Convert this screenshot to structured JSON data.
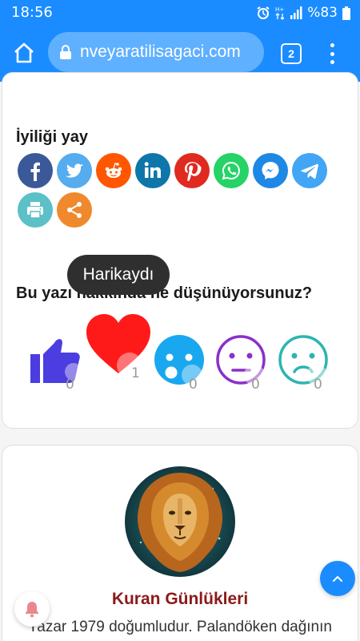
{
  "status_bar": {
    "time": "18:56",
    "battery": "%83"
  },
  "browser": {
    "url": "nveyaratilisagaci.com",
    "tab_count": "2"
  },
  "share": {
    "title": "İyiliği yay",
    "buttons": [
      {
        "icon": "facebook-icon",
        "color": "#3b5998"
      },
      {
        "icon": "twitter-icon",
        "color": "#55acee"
      },
      {
        "icon": "reddit-icon",
        "color": "#ff5700"
      },
      {
        "icon": "linkedin-icon",
        "color": "#0e76a8"
      },
      {
        "icon": "pinterest-icon",
        "color": "#e02a20"
      },
      {
        "icon": "whatsapp-icon",
        "color": "#25d366"
      },
      {
        "icon": "messenger-icon",
        "color": "#1e88e5"
      },
      {
        "icon": "telegram-icon",
        "color": "#42a5f5"
      },
      {
        "icon": "print-icon",
        "color": "#5bc0c7"
      },
      {
        "icon": "share-icon",
        "color": "#f0892d"
      }
    ]
  },
  "reactions": {
    "tooltip": "Harikaydı",
    "question": "Bu yazı hakkında ne düşünüyorsunuz?",
    "items": [
      {
        "name": "like",
        "count": "0"
      },
      {
        "name": "love",
        "count": "1"
      },
      {
        "name": "wow",
        "count": "0"
      },
      {
        "name": "neutral",
        "count": "0"
      },
      {
        "name": "sad",
        "count": "0"
      }
    ]
  },
  "author": {
    "name": "Kuran Günlükleri",
    "bio": "Yazar 1979 doğumludur. Palandöken dağının"
  },
  "colors": {
    "brand": "#1a8cff",
    "author_name": "#8b1a1a"
  }
}
